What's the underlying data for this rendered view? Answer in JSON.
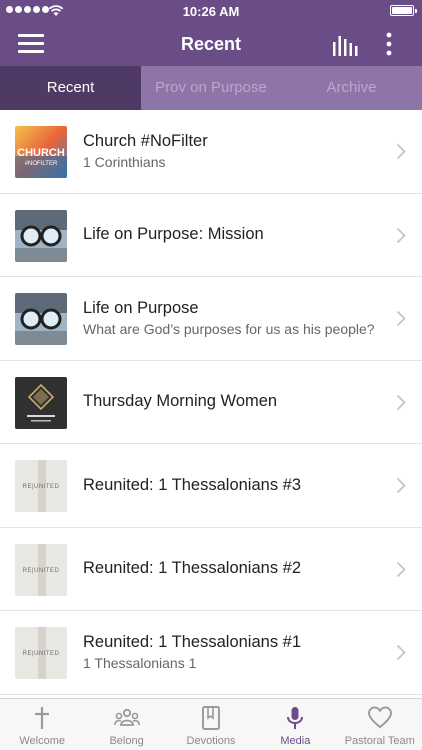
{
  "status_bar": {
    "time": "10:26 AM"
  },
  "nav": {
    "title": "Recent"
  },
  "tabs": [
    {
      "label": "Recent"
    },
    {
      "label": "Prov on Purpose"
    },
    {
      "label": "Archive"
    }
  ],
  "items": [
    {
      "title": "Church #NoFilter",
      "subtitle": "1 Corinthians",
      "thumb_text": [
        "CHURCH",
        "#NOFILTER"
      ]
    },
    {
      "title": "Life on Purpose: Mission",
      "subtitle": ""
    },
    {
      "title": "Life on Purpose",
      "subtitle": "What are God’s purposes for us as his people?"
    },
    {
      "title": "Thursday Morning Women",
      "subtitle": ""
    },
    {
      "title": "Reunited: 1 Thessalonians #3",
      "subtitle": "",
      "thumb_text": "RE|UNITED"
    },
    {
      "title": "Reunited: 1 Thessalonians #2",
      "subtitle": "",
      "thumb_text": "RE|UNITED"
    },
    {
      "title": "Reunited: 1 Thessalonians #1",
      "subtitle": "1 Thessalonians 1",
      "thumb_text": "RE|UNITED"
    }
  ],
  "tabbar": [
    {
      "label": "Welcome",
      "icon": "cross-icon"
    },
    {
      "label": "Belong",
      "icon": "people-icon"
    },
    {
      "label": "Devotions",
      "icon": "book-icon"
    },
    {
      "label": "Media",
      "icon": "microphone-icon",
      "active": true
    },
    {
      "label": "Pastoral Team",
      "icon": "heart-icon"
    }
  ],
  "colors": {
    "brand": "#6a4d87",
    "tab_active": "#4f3a66",
    "tab_bg": "#8d75a8"
  }
}
